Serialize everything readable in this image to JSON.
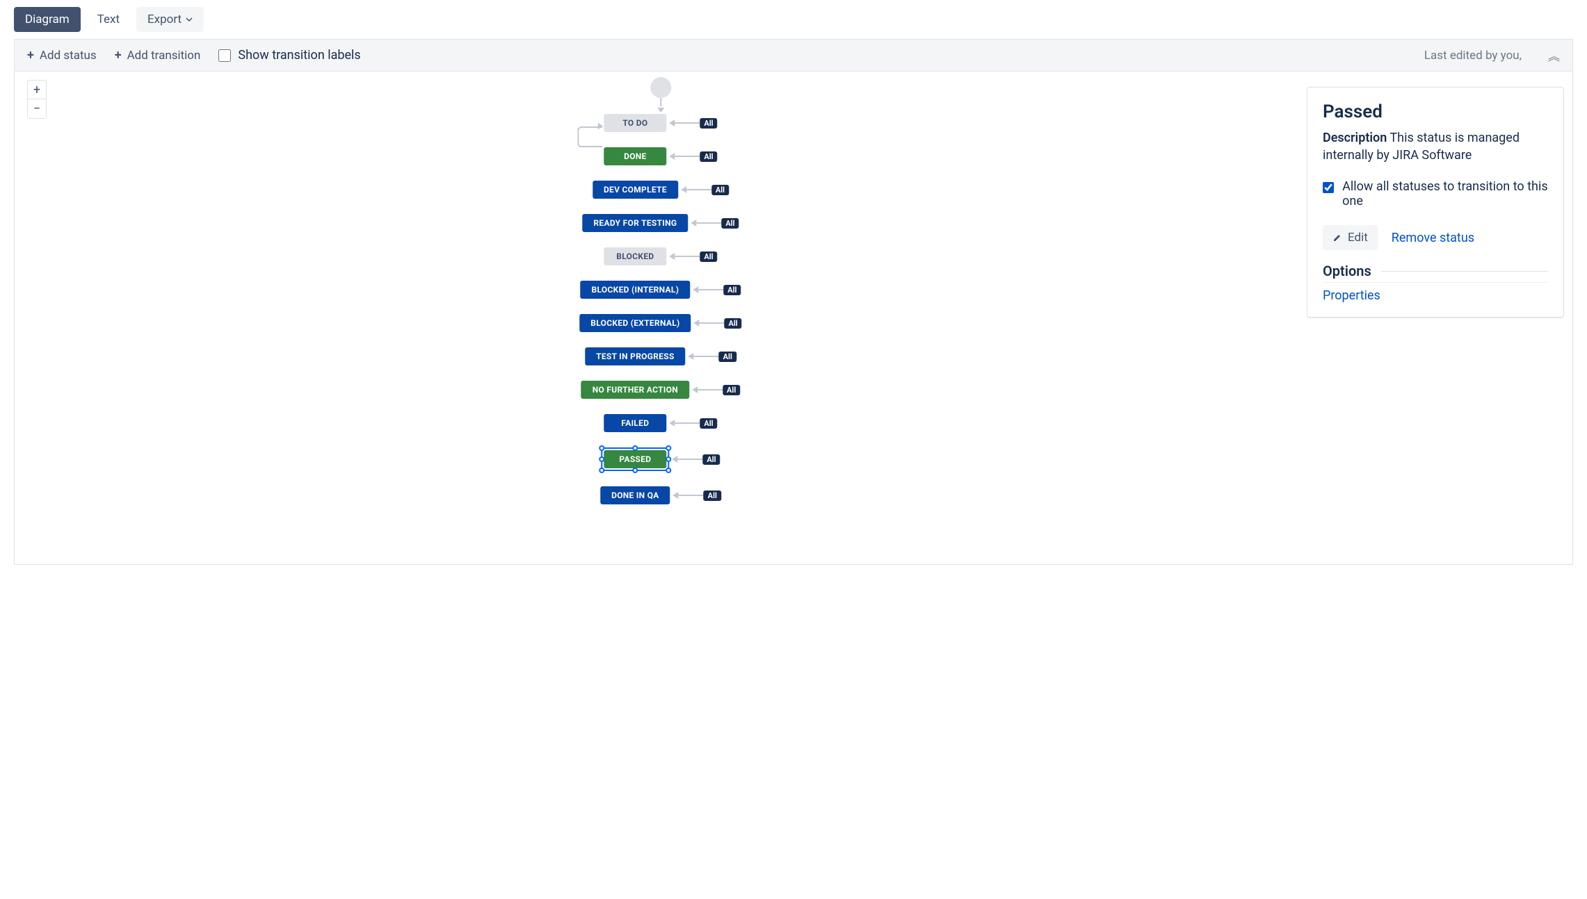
{
  "tabs": {
    "diagram": "Diagram",
    "text": "Text",
    "export": "Export"
  },
  "toolbar": {
    "add_status": "Add status",
    "add_transition": "Add transition",
    "show_labels": "Show transition labels",
    "last_edited": "Last edited by you,"
  },
  "zoom": {
    "in": "+",
    "out": "−"
  },
  "all_badge": "All",
  "statuses": [
    {
      "label": "TO DO",
      "category": "todo",
      "selected": false,
      "loopback": true
    },
    {
      "label": "DONE",
      "category": "done",
      "selected": false
    },
    {
      "label": "DEV COMPLETE",
      "category": "inprogress",
      "selected": false
    },
    {
      "label": "READY FOR TESTING",
      "category": "inprogress",
      "selected": false
    },
    {
      "label": "BLOCKED",
      "category": "todo",
      "selected": false
    },
    {
      "label": "BLOCKED (INTERNAL)",
      "category": "inprogress",
      "selected": false
    },
    {
      "label": "BLOCKED (EXTERNAL)",
      "category": "inprogress",
      "selected": false
    },
    {
      "label": "TEST IN PROGRESS",
      "category": "inprogress",
      "selected": false
    },
    {
      "label": "NO FURTHER ACTION",
      "category": "done",
      "selected": false
    },
    {
      "label": "FAILED",
      "category": "inprogress",
      "selected": false
    },
    {
      "label": "PASSED",
      "category": "done",
      "selected": true
    },
    {
      "label": "DONE IN QA",
      "category": "inprogress",
      "selected": false
    }
  ],
  "detail": {
    "title": "Passed",
    "description_label": "Description",
    "description_text": "This status is managed internally by JIRA Software",
    "allow_all_label": "Allow all statuses to transition to this one",
    "allow_all_checked": true,
    "edit": "Edit",
    "remove": "Remove status",
    "options_header": "Options",
    "properties": "Properties"
  }
}
